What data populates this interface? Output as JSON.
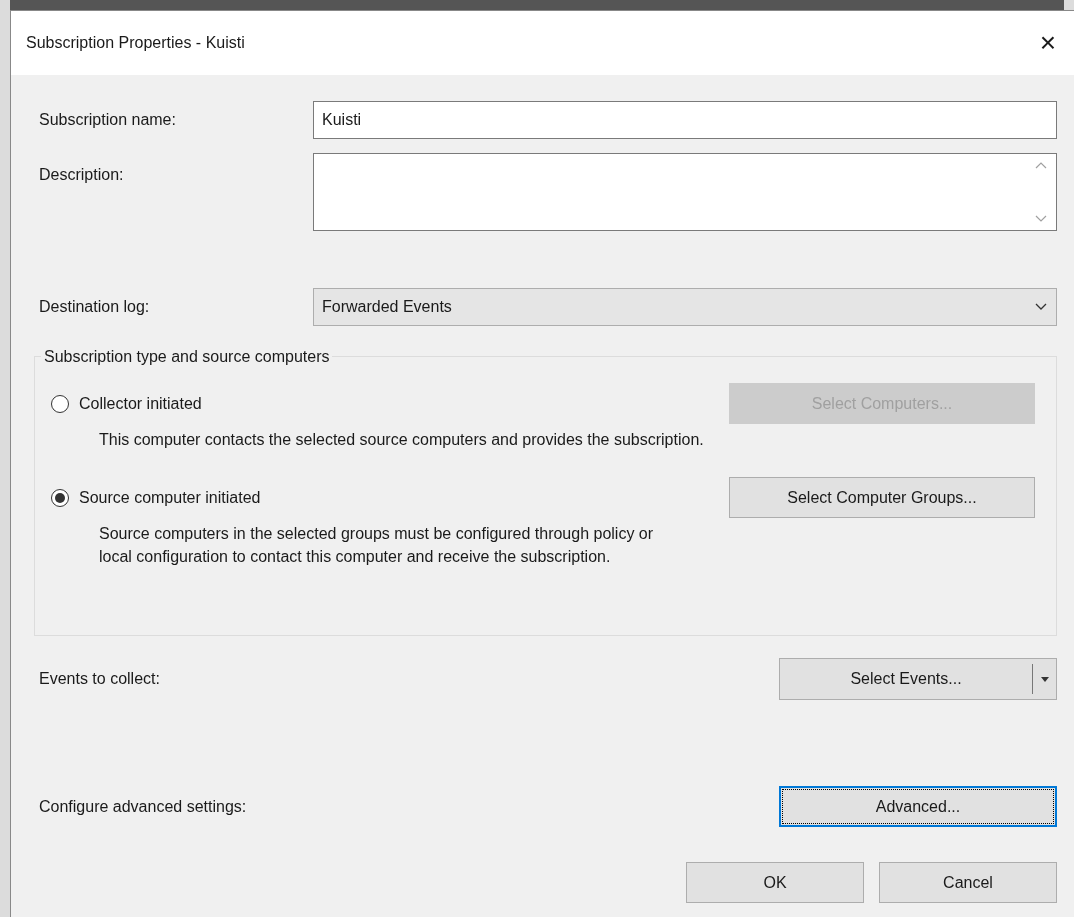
{
  "window": {
    "title": "Subscription Properties - Kuisti",
    "close": "×"
  },
  "fields": {
    "name": {
      "label": "Subscription name:",
      "value": "Kuisti"
    },
    "description": {
      "label": "Description:"
    },
    "destination": {
      "label": "Destination log:",
      "value": "Forwarded Events"
    }
  },
  "subscription_type": {
    "title": "Subscription type and source computers",
    "options": [
      {
        "label": "Collector initiated",
        "selected": false,
        "button": {
          "label": "Select Computers...",
          "disabled": true
        },
        "description": "This computer contacts the selected source computers and provides the subscription."
      },
      {
        "label": "Source computer initiated",
        "selected": true,
        "button": {
          "label": "Select Computer Groups...",
          "disabled": false
        },
        "description": "Source computers in the selected groups must be configured through policy or\nlocal configuration to contact this computer and receive the subscription."
      }
    ]
  },
  "events": {
    "label": "Events to collect:",
    "button": "Select Events..."
  },
  "advanced": {
    "label": "Configure advanced settings:",
    "button": {
      "label": "Advanced...",
      "focused": true
    }
  },
  "buttons": [
    "OK",
    "Cancel"
  ]
}
